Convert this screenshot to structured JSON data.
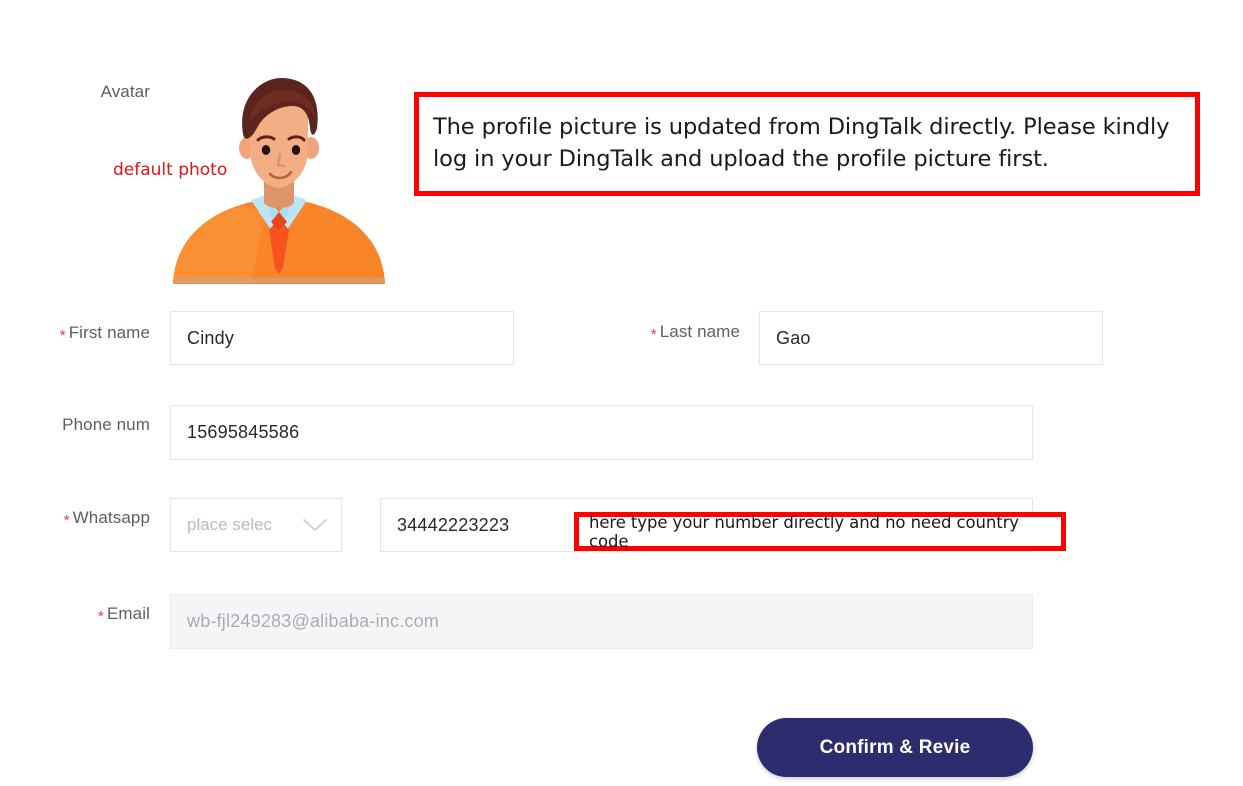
{
  "form": {
    "avatar": {
      "label": "Avatar",
      "note": "default photo",
      "icon": "user-avatar-illustration"
    },
    "fields": {
      "first_name": {
        "label": "First name",
        "required_mark": "*",
        "value": "Cindy"
      },
      "last_name": {
        "label": "Last name",
        "required_mark": "*",
        "value": "Gao"
      },
      "phone": {
        "label": "Phone num",
        "value": "15695845586"
      },
      "whatsapp": {
        "label": "Whatsapp",
        "required_mark": "*",
        "country_placeholder": "place selec",
        "dropdown_icon": "chevron-down-icon",
        "value": "34442223223"
      },
      "email": {
        "label": "Email",
        "required_mark": "*",
        "value": "wb-fjl249283@alibaba-inc.com",
        "state": "disabled"
      }
    },
    "submit": {
      "label": "Confirm & Revie"
    }
  },
  "annotations": {
    "avatar_note": "The profile picture is updated from DingTalk directly. Please kindly log in your DingTalk and upload the profile picture first.",
    "whatsapp_note": "here type your number directly and no need country code"
  },
  "colors": {
    "annotation_border": "#ff0000",
    "annotation_text": "#e11313",
    "required": "#e8374a",
    "button": "#2b2d6e",
    "field_border": "#e4e6ea",
    "disabled_bg": "#f4f5f7"
  }
}
